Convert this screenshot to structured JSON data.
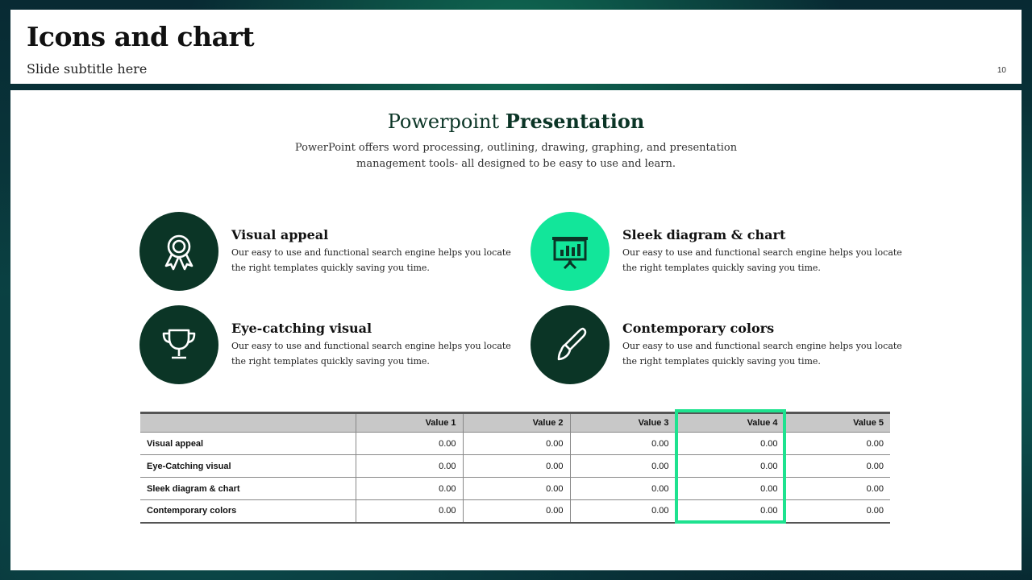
{
  "header": {
    "title": "Icons and chart",
    "subtitle": "Slide subtitle here",
    "page_number": "10"
  },
  "main": {
    "title_regular": "Powerpoint",
    "title_bold": "Presentation",
    "intro": "PowerPoint offers word processing, outlining, drawing, graphing, and presentation management tools- all designed to be easy to use and learn."
  },
  "features": [
    {
      "title": "Visual appeal",
      "desc": "Our easy to use and functional search engine helps you locate the right templates  quickly saving you time.",
      "icon": "award-ribbon-icon",
      "circle_color": "#0b3526"
    },
    {
      "title": "Sleek diagram & chart",
      "desc": "Our easy to use and functional search engine helps you locate the right templates  quickly saving you time.",
      "icon": "presentation-chart-icon",
      "circle_color": "#12e69a"
    },
    {
      "title": "Eye-catching visual",
      "desc": "Our easy to use and functional search engine helps you locate the right templates  quickly saving you time.",
      "icon": "trophy-icon",
      "circle_color": "#0b3526"
    },
    {
      "title": "Contemporary colors",
      "desc": "Our easy to use and functional search engine helps you locate the right templates  quickly saving you time.",
      "icon": "paintbrush-icon",
      "circle_color": "#0b3526"
    }
  ],
  "table": {
    "headers": [
      "",
      "Value 1",
      "Value 2",
      "Value 3",
      "Value 4",
      "Value 5"
    ],
    "rows": [
      {
        "label": "Visual appeal",
        "values": [
          "0.00",
          "0.00",
          "0.00",
          "0.00",
          "0.00"
        ]
      },
      {
        "label": "Eye-Catching visual",
        "values": [
          "0.00",
          "0.00",
          "0.00",
          "0.00",
          "0.00"
        ]
      },
      {
        "label": "Sleek diagram & chart",
        "values": [
          "0.00",
          "0.00",
          "0.00",
          "0.00",
          "0.00"
        ]
      },
      {
        "label": "Contemporary colors",
        "values": [
          "0.00",
          "0.00",
          "0.00",
          "0.00",
          "0.00"
        ]
      }
    ],
    "highlight_column": "Value 4",
    "highlight_color": "#1ee28f"
  }
}
